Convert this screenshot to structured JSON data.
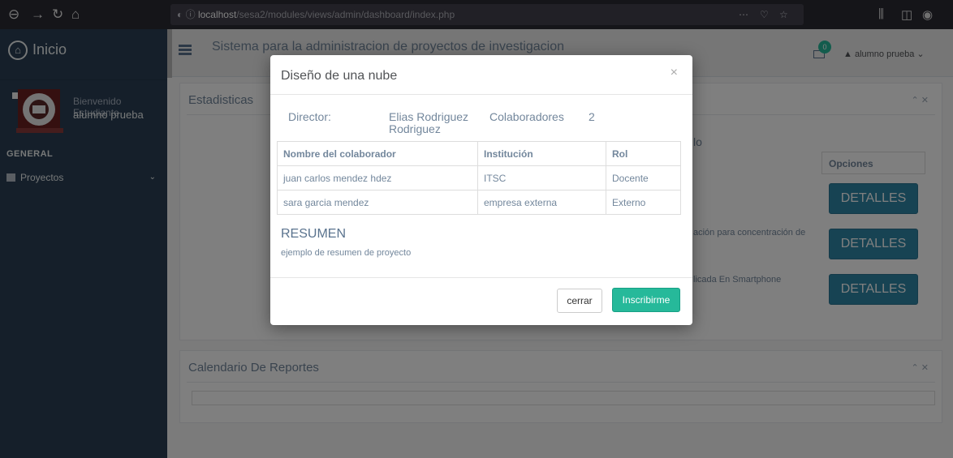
{
  "browser": {
    "url_host": "localhost",
    "url_path": "/sesa2/modules/views/admin/dashboard/index.php",
    "url_full_prefix": "ⓘ ",
    "dots": "⋯"
  },
  "sidebar": {
    "brand": "Inicio",
    "welcome": "Bienvenido Estudiante",
    "user_name": "alumno prueba",
    "section": "GENERAL",
    "menu": [
      {
        "label": "Proyectos"
      }
    ]
  },
  "topnav": {
    "title": "Sistema para la administracion de proyectos de investigacion",
    "mail_count": "0",
    "user": "alumno prueba"
  },
  "panels": {
    "stats_title": "Estadisticas",
    "calendar_title": "Calendario De Reportes",
    "options_header": "Opciones",
    "details_label": "DETALLES",
    "partial_header": "lo",
    "row2_text": "ación para concentración de",
    "row3_text": "licada En Smartphone"
  },
  "modal": {
    "title": "Diseño de una nube",
    "director_label": "Director:",
    "director_line1": "Elias Rodriguez",
    "director_line2": "Rodriguez",
    "collab_label": "Colaboradores",
    "collab_count": "2",
    "table": {
      "headers": [
        "Nombre del colaborador",
        "Institución",
        "Rol"
      ],
      "rows": [
        [
          "juan carlos mendez hdez",
          "ITSC",
          "Docente"
        ],
        [
          "sara garcia mendez",
          "empresa externa",
          "Externo"
        ]
      ]
    },
    "summary_heading": "RESUMEN",
    "summary_text": "ejemplo de resumen de proyecto",
    "close_button": "cerrar",
    "enroll_button": "Inscribirme"
  },
  "colors": {
    "sidebar": "#2a3f54",
    "accent_green": "#26b99a",
    "details_blue": "#2f87a6"
  }
}
